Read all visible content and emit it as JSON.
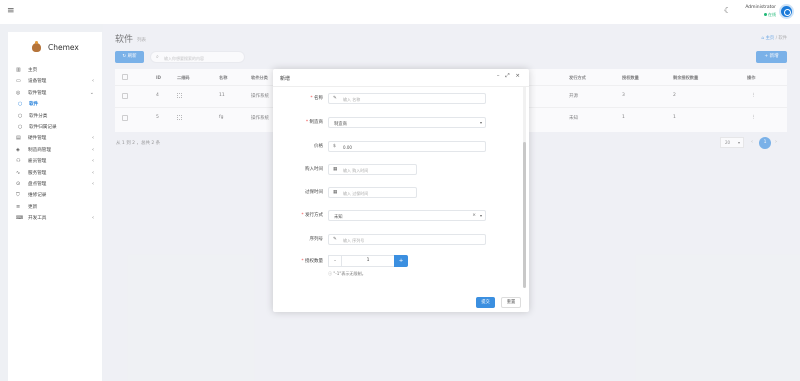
{
  "topbar": {
    "menu_icon": "hamburger-icon",
    "theme_icon": "moon-icon",
    "user_name": "Administrator",
    "user_status": "在线"
  },
  "sidebar": {
    "brand": "Chemex",
    "items": [
      {
        "label": "主页",
        "icon": "chart-icon",
        "chevron": ""
      },
      {
        "label": "设备管理",
        "icon": "monitor-icon",
        "chevron": "‹"
      },
      {
        "label": "软件管理",
        "icon": "disc-icon",
        "chevron": "⌄"
      },
      {
        "label": "软件",
        "icon": "circle-icon",
        "chevron": ""
      },
      {
        "label": "软件分类",
        "icon": "circle-icon",
        "chevron": ""
      },
      {
        "label": "软件归属记录",
        "icon": "circle-icon",
        "chevron": ""
      },
      {
        "label": "硬件管理",
        "icon": "drive-icon",
        "chevron": "‹"
      },
      {
        "label": "制造商管理",
        "icon": "cube-icon",
        "chevron": "‹"
      },
      {
        "label": "雇员管理",
        "icon": "users-icon",
        "chevron": "‹"
      },
      {
        "label": "服务管理",
        "icon": "pulse-icon",
        "chevron": "‹"
      },
      {
        "label": "盘点管理",
        "icon": "check-icon",
        "chevron": "‹"
      },
      {
        "label": "维修记录",
        "icon": "shield-icon",
        "chevron": ""
      },
      {
        "label": "更新",
        "icon": "update-icon",
        "chevron": ""
      },
      {
        "label": "开发工具",
        "icon": "keyboard-icon",
        "chevron": "‹"
      }
    ]
  },
  "page": {
    "title": "软件",
    "subtitle": "列表",
    "breadcrumb_home": "主页",
    "breadcrumb_sep": "/",
    "breadcrumb_current": "软件"
  },
  "toolbar": {
    "refresh_label": "刷新",
    "search_placeholder": "输入你想要搜索的内容",
    "add_label": "+ 新增"
  },
  "table": {
    "headers": [
      "ID",
      "二维码",
      "名称",
      "软件分类",
      "发行方式",
      "授权数量",
      "剩余授权数量",
      "操作"
    ],
    "rows": [
      {
        "id": "4",
        "name": "11",
        "category": "操作系统",
        "distribution": "开源",
        "licenses": "3",
        "remaining": "2",
        "action": "⋮"
      },
      {
        "id": "5",
        "name": "fg",
        "category": "操作系统",
        "distribution": "未知",
        "licenses": "1",
        "remaining": "1",
        "action": "⋮"
      }
    ]
  },
  "footer": {
    "info": "从 1 到 2 ，总共 2 条",
    "page_size": "20",
    "prev": "‹",
    "current_page": "1",
    "next": "›"
  },
  "modal": {
    "title": "新增",
    "controls": "– ⤢ ×",
    "fields": {
      "name": {
        "label": "名称",
        "placeholder": "输入 名称",
        "icon": "pencil-icon"
      },
      "manufacturer": {
        "label": "制造商",
        "value": "制造商"
      },
      "price": {
        "label": "价格",
        "prefix": "$",
        "value": "0.00"
      },
      "purchased": {
        "label": "购入时间",
        "placeholder": "输入 购入时间",
        "icon": "calendar-icon"
      },
      "expired": {
        "label": "过保时间",
        "placeholder": "输入 过保时间",
        "icon": "calendar-icon"
      },
      "distribution": {
        "label": "发行方式",
        "value": "未知"
      },
      "sn": {
        "label": "序列号",
        "placeholder": "输入 序列号",
        "icon": "pencil-icon"
      },
      "counts": {
        "label": "授权数量",
        "value": "1"
      }
    },
    "help": "ⓘ \"-1\"表示无限制。",
    "submit": "提交",
    "reset": "重置"
  }
}
